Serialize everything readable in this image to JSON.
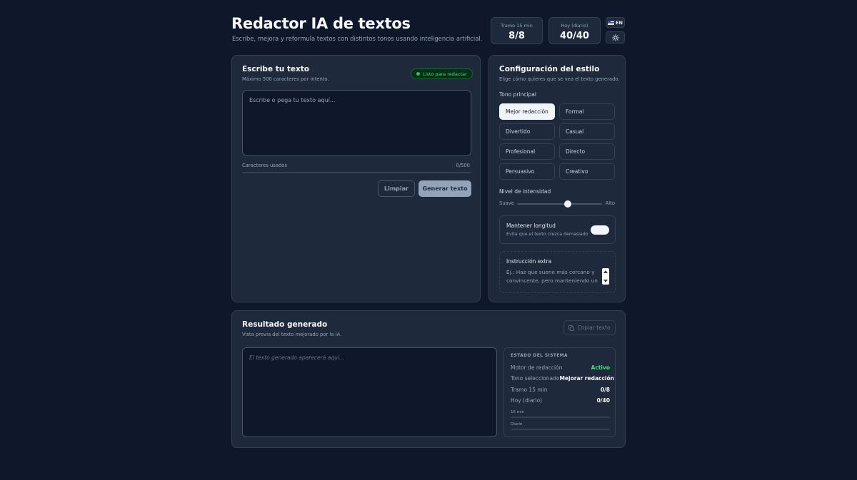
{
  "header": {
    "title": "Redactor IA de textos",
    "subtitle": "Escribe, mejora y reformula textos con distintos tonos usando inteligencia artificial.",
    "stats": [
      {
        "label": "Tramo 15 min",
        "value": "8/8"
      },
      {
        "label": "Hoy (diario)",
        "value": "40/40"
      }
    ],
    "lang_label": "EN",
    "lang_icon": "us-flag-icon",
    "theme_icon": "sun-icon"
  },
  "editor": {
    "title": "Escribe tu texto",
    "subtitle": "Máximo 500 caracteres por intento.",
    "badge": "Listo para redactar",
    "placeholder": "Escribe o pega tu texto aquí...",
    "chars_label": "Caracteres usados",
    "chars_value": "0/500",
    "chars_progress": 0,
    "clear_label": "Limpiar",
    "generate_label": "Generar texto"
  },
  "style": {
    "title": "Configuración del estilo",
    "subtitle": "Elige cómo quieres que se vea el texto generado.",
    "tone_label": "Tono principal",
    "tones": [
      {
        "label": "Mejor redacción",
        "active": true
      },
      {
        "label": "Formal",
        "active": false
      },
      {
        "label": "Divertido",
        "active": false
      },
      {
        "label": "Casual",
        "active": false
      },
      {
        "label": "Profesional",
        "active": false
      },
      {
        "label": "Directo",
        "active": false
      },
      {
        "label": "Persuasivo",
        "active": false
      },
      {
        "label": "Creativo",
        "active": false
      }
    ],
    "intensity_label": "Nivel de intensidad",
    "intensity_low": "Suave",
    "intensity_high": "Alto",
    "intensity_value": 0.6,
    "keep_length_title": "Mantener longitud",
    "keep_length_sub": "Evita que el texto crezca demasiado",
    "keep_length_on": true,
    "extra_title": "Instrucción extra",
    "extra_placeholder": "Ej.: Haz que suene más cercano y convincente, pero manteniendo un"
  },
  "result": {
    "title": "Resultado generado",
    "subtitle": "Vista previa del texto mejorado por la IA.",
    "copy_label": "Copiar texto",
    "copy_icon": "copy-icon",
    "placeholder": "El texto generado aparecerá aquí...",
    "system": {
      "title": "ESTADO DEL SISTEMA",
      "rows": [
        {
          "key": "Motor de redacción",
          "value": "Activo"
        },
        {
          "key": "Tono seleccionado",
          "value": "Mejorar redacción"
        },
        {
          "key": "Tramo 15 min",
          "value": "0/8"
        },
        {
          "key": "Hoy (diario)",
          "value": "0/40"
        }
      ],
      "bar1_label": "15 min",
      "bar2_label": "Diario"
    }
  },
  "colors": {
    "background": "#0f172a",
    "card": "#1e293b",
    "accent_green": "#4ade80"
  }
}
